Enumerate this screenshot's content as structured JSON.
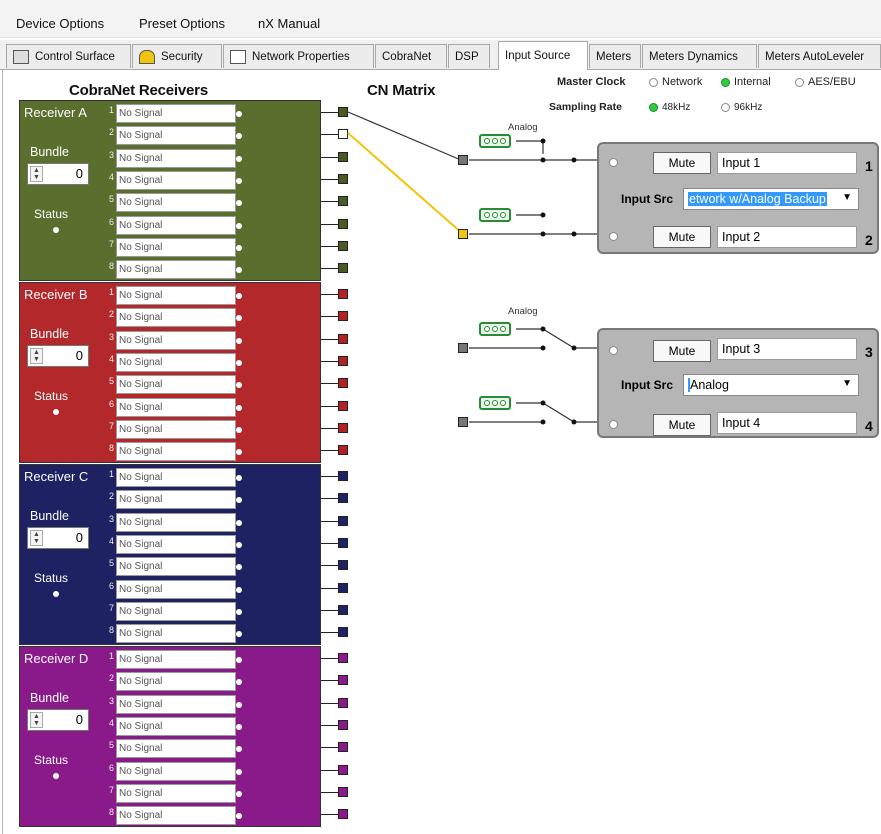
{
  "menu": {
    "items": [
      "Device Options",
      "Preset Options",
      "nX Manual"
    ]
  },
  "tabs": [
    {
      "label": "Control Surface",
      "icon": "control-surface-icon"
    },
    {
      "label": "Security",
      "icon": "security-icon"
    },
    {
      "label": "Network Properties",
      "icon": "network-properties-icon"
    },
    {
      "label": "CobraNet"
    },
    {
      "label": "DSP"
    },
    {
      "label": "Input Source",
      "active": true
    },
    {
      "label": "Meters"
    },
    {
      "label": "Meters Dynamics"
    },
    {
      "label": "Meters AutoLeveler"
    }
  ],
  "headings": {
    "receivers": "CobraNet Receivers",
    "matrix": "CN Matrix"
  },
  "master_clock": {
    "label": "Master Clock",
    "options": [
      "Network",
      "Internal",
      "AES/EBU"
    ],
    "selected": "Internal"
  },
  "sampling_rate": {
    "label": "Sampling Rate",
    "options": [
      "48kHz",
      "96kHz"
    ],
    "selected": "48kHz"
  },
  "receivers": [
    {
      "label": "Receiver A",
      "bundle_label": "Bundle",
      "bundle": "0",
      "status_label": "Status",
      "color": "#5a6e2e",
      "conn_color": "#4a5a24",
      "channels": [
        "No Signal",
        "No Signal",
        "No Signal",
        "No Signal",
        "No Signal",
        "No Signal",
        "No Signal",
        "No Signal"
      ]
    },
    {
      "label": "Receiver B",
      "bundle_label": "Bundle",
      "bundle": "0",
      "status_label": "Status",
      "color": "#b3282a",
      "conn_color": "#b22222",
      "channels": [
        "No Signal",
        "No Signal",
        "No Signal",
        "No Signal",
        "No Signal",
        "No Signal",
        "No Signal",
        "No Signal"
      ]
    },
    {
      "label": "Receiver C",
      "bundle_label": "Bundle",
      "bundle": "0",
      "status_label": "Status",
      "color": "#1e2262",
      "conn_color": "#1c2466",
      "channels": [
        "No Signal",
        "No Signal",
        "No Signal",
        "No Signal",
        "No Signal",
        "No Signal",
        "No Signal",
        "No Signal"
      ]
    },
    {
      "label": "Receiver D",
      "bundle_label": "Bundle",
      "bundle": "0",
      "status_label": "Status",
      "color": "#8a1a8a",
      "conn_color": "#8a1a8a",
      "channels": [
        "No Signal",
        "No Signal",
        "No Signal",
        "No Signal",
        "No Signal",
        "No Signal",
        "No Signal",
        "No Signal"
      ]
    }
  ],
  "analog_label": "Analog",
  "input_groups": [
    {
      "src_label": "Input Src",
      "src_value_highlight": "etwork w/Analog Backup",
      "src_value": "",
      "inputs": [
        {
          "mute": "Mute",
          "name": "Input 1",
          "num": "1"
        },
        {
          "mute": "Mute",
          "name": "Input 2",
          "num": "2"
        }
      ]
    },
    {
      "src_label": "Input Src",
      "src_value_highlight": "",
      "src_value": "Analog",
      "inputs": [
        {
          "mute": "Mute",
          "name": "Input 3",
          "num": "3"
        },
        {
          "mute": "Mute",
          "name": "Input 4",
          "num": "4"
        }
      ]
    }
  ]
}
